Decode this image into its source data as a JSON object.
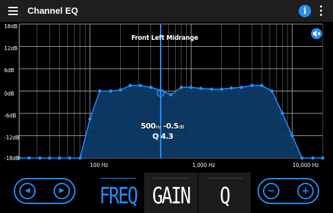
{
  "app": {
    "title": "Channel EQ",
    "menu_icon": "hamburger-menu-icon",
    "info_icon": "info-icon",
    "more_icon": "more-vert-icon",
    "info_glyph": "i"
  },
  "graph": {
    "channel_name": "Front Left Midrange",
    "speaker_icon": "speaker-mute-icon",
    "y_labels": [
      "18dB",
      "12dB",
      "6dB",
      "0dB",
      "-6dB",
      "-12dB",
      "-18dB"
    ],
    "x_labels": [
      "100 Hz",
      "1,000 Hz",
      "10,000 Hz"
    ],
    "readout_freq": "500",
    "readout_freq_unit": "Hz",
    "readout_gain": "-0.5",
    "readout_gain_unit": "dB",
    "readout_q": "Q 4.3",
    "colors": {
      "accent": "#1f8fff",
      "fill": "#0c3a66",
      "grid": "#7a7a7a"
    }
  },
  "controls": {
    "left_glyph": "◀",
    "right_glyph": "▶",
    "minus_glyph": "−",
    "plus_glyph": "+",
    "tabs": [
      "FREQ",
      "GAIN",
      "Q"
    ],
    "selected_tab": "FREQ"
  },
  "chart_data": {
    "type": "area",
    "x_scale": "log",
    "xlim": [
      20,
      20000
    ],
    "ylim": [
      -18,
      18
    ],
    "grid": true,
    "selected_band": {
      "freq": 500,
      "gain": -0.5,
      "q": 4.3
    },
    "x": [
      20,
      25,
      32,
      40,
      50,
      63,
      80,
      100,
      125,
      160,
      200,
      250,
      315,
      400,
      500,
      630,
      800,
      1000,
      1250,
      1600,
      2000,
      2500,
      3150,
      4000,
      5000,
      6300,
      8000,
      10000,
      12500,
      16000,
      20000
    ],
    "y": [
      -18,
      -18,
      -18,
      -18,
      -18,
      -18,
      -18,
      -7.5,
      0,
      0,
      0.3,
      1.5,
      1.5,
      1,
      0.2,
      -1,
      1,
      1,
      0.7,
      0.5,
      0.5,
      0.8,
      1,
      1.5,
      1.5,
      0,
      -6,
      -12,
      -18,
      -18,
      -18
    ]
  }
}
